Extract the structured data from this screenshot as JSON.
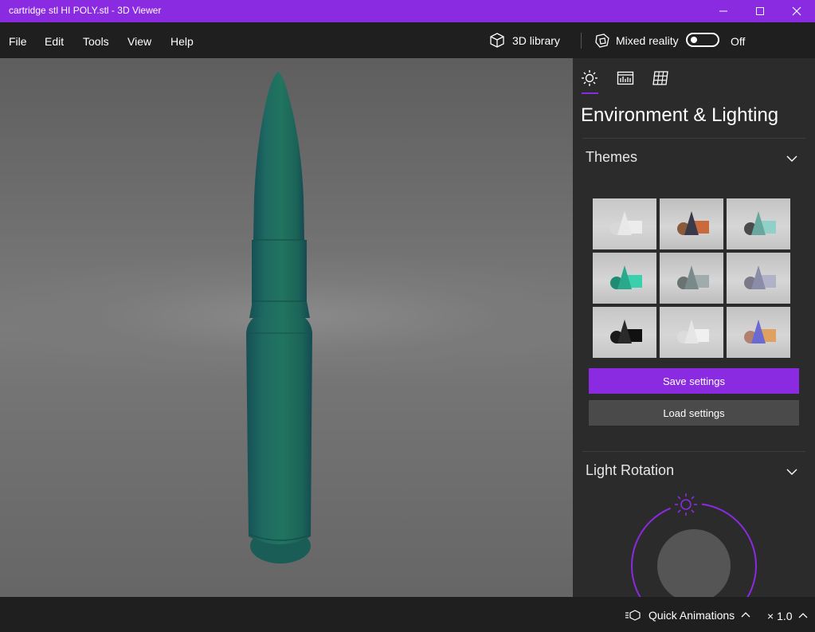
{
  "window": {
    "title": "cartridge stl HI POLY.stl - 3D Viewer"
  },
  "menu": {
    "items": [
      "File",
      "Edit",
      "Tools",
      "View",
      "Help"
    ]
  },
  "toolbar": {
    "library_label": "3D library",
    "mixed_reality_label": "Mixed reality",
    "mixed_reality_state": "Off"
  },
  "panel": {
    "title": "Environment & Lighting",
    "tabs": [
      {
        "name": "environment-lighting",
        "icon": "sun-icon",
        "active": true
      },
      {
        "name": "stats-shading",
        "icon": "stats-icon",
        "active": false
      },
      {
        "name": "mesh",
        "icon": "grid-icon",
        "active": false
      }
    ],
    "themes_heading": "Themes",
    "save_label": "Save settings",
    "load_label": "Load settings",
    "light_rotation_heading": "Light Rotation"
  },
  "status": {
    "animations_label": "Quick Animations",
    "speed": "× 1.0"
  },
  "colors": {
    "accent": "#8a2be2",
    "model": "#1f6d60",
    "background": "#1f1f1f",
    "panel": "#2b2b2b"
  },
  "themes": [
    {
      "bg": "#c8c8c8",
      "a": "#e8e8e8",
      "b": "#ececec",
      "c": "#d8d8d8"
    },
    {
      "bg": "#bfbfbf",
      "a": "#3a3b4a",
      "b": "#c86a3c",
      "c": "#8a5a3a"
    },
    {
      "bg": "#c4c4c4",
      "a": "#6aa6a0",
      "b": "#8fd0c8",
      "c": "#4a4a4a"
    },
    {
      "bg": "#c0c0c0",
      "a": "#2aa88c",
      "b": "#3ccfae",
      "c": "#1e8b73"
    },
    {
      "bg": "#bdbdbd",
      "a": "#7a8a8a",
      "b": "#a0acac",
      "c": "#6a7272"
    },
    {
      "bg": "#c2c2c2",
      "a": "#8a8ca8",
      "b": "#b0b2c8",
      "c": "#7a7a8a"
    },
    {
      "bg": "#c6c6c6",
      "a": "#2a2a2a",
      "b": "#111111",
      "c": "#1a1a1a"
    },
    {
      "bg": "#c8c8c8",
      "a": "#e6e6e6",
      "b": "#f0f0f0",
      "c": "#dcdcdc"
    },
    {
      "bg": "#c2c2c2",
      "a": "#6a6ad0",
      "b": "#e0a060",
      "c": "#b08070"
    }
  ]
}
